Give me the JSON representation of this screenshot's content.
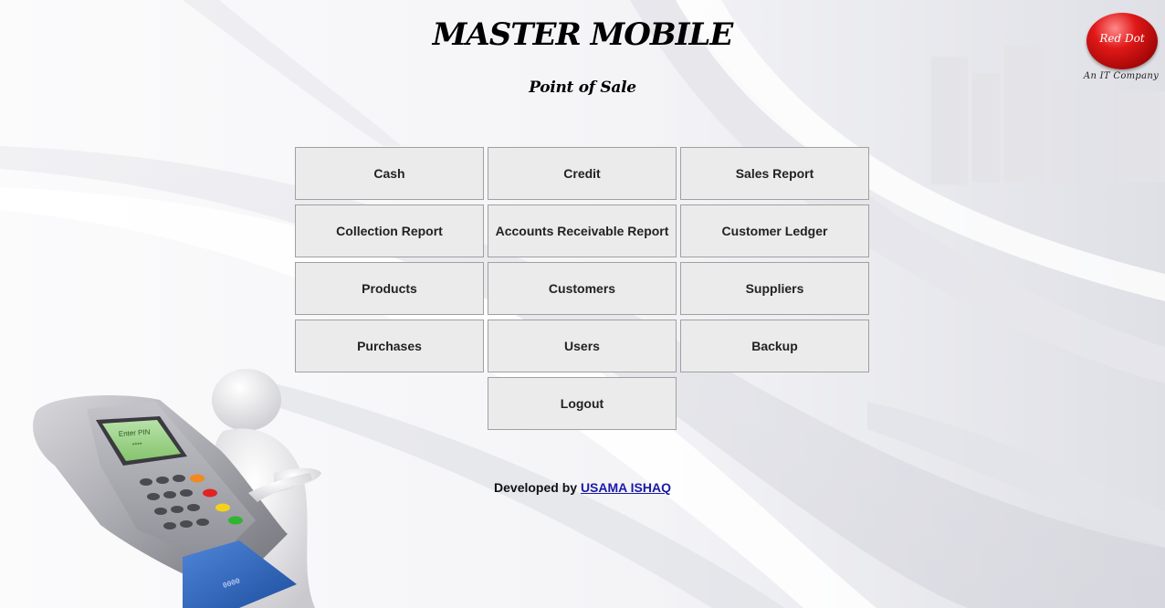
{
  "header": {
    "title": "MASTER MOBILE",
    "subtitle": "Point of Sale"
  },
  "logo": {
    "brand": "Red Dot",
    "tagline": "An IT Company",
    "color": "#d41414"
  },
  "menu": {
    "cash": "Cash",
    "credit": "Credit",
    "sales_report": "Sales Report",
    "collection_report": "Collection Report",
    "accounts_receivable_report": "Accounts Receivable Report",
    "customer_ledger": "Customer Ledger",
    "products": "Products",
    "customers": "Customers",
    "suppliers": "Suppliers",
    "purchases": "Purchases",
    "users": "Users",
    "backup": "Backup",
    "logout": "Logout"
  },
  "footer": {
    "prefix": "Developed by",
    "author": "USAMA ISHAQ"
  },
  "illustration": {
    "terminal_screen_text": "Enter PIN",
    "terminal_screen_mask": "****",
    "card_number_fragment": "0000"
  }
}
